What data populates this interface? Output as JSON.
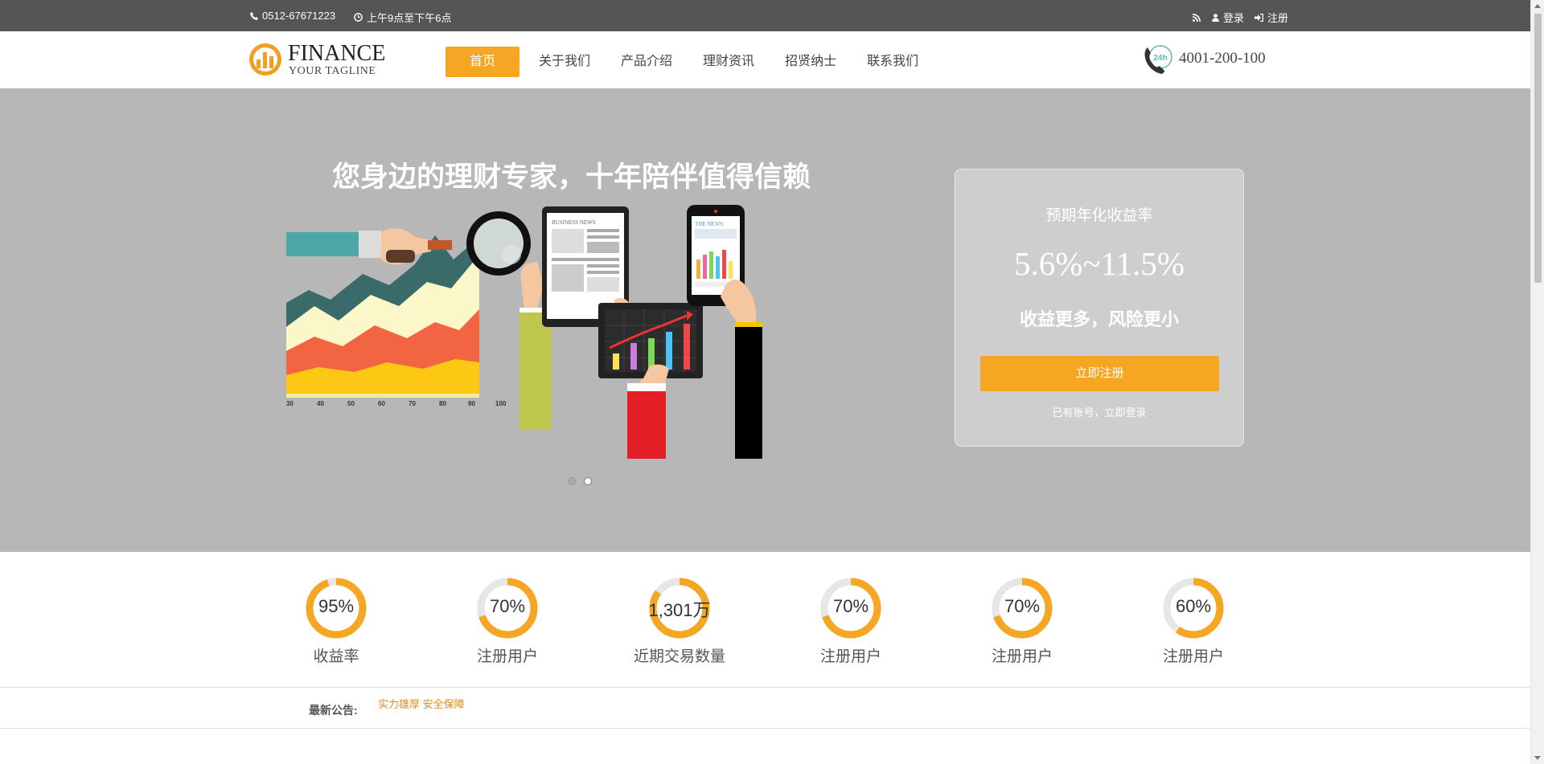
{
  "topbar": {
    "phone": "0512-67671223",
    "hours": "上午9点至下午6点",
    "login": "登录",
    "register": "注册"
  },
  "header": {
    "logo_title": "FINANCE",
    "logo_tagline": "YOUR TAGLINE",
    "nav": [
      "首页",
      "关于我们",
      "产品介绍",
      "理财资讯",
      "招贤纳士",
      "联系我们"
    ],
    "active_nav": "首页",
    "hotline_badge": "24h",
    "hotline": "4001-200-100"
  },
  "hero": {
    "title": "您身边的理财专家，十年陪伴值得信赖",
    "axis_ticks": [
      "30",
      "40",
      "50",
      "60",
      "70",
      "80",
      "90",
      "100"
    ],
    "tablet_headline": "BUSINESS NEWS",
    "phone_headline": "THE NEWS",
    "slide_count": 2,
    "active_slide": 2
  },
  "card": {
    "label": "预期年化收益率",
    "rate": "5.6%~11.5%",
    "slogan": "收益更多，风险更小",
    "register_button": "立即注册",
    "login_link": "已有账号，立即登录"
  },
  "stats": [
    {
      "value": "95%",
      "label": "收益率",
      "fraction": 0.95
    },
    {
      "value": "70%",
      "label": "注册用户",
      "fraction": 0.7
    },
    {
      "value": "1,301万",
      "label": "近期交易数量",
      "fraction": 0.85
    },
    {
      "value": "70%",
      "label": "注册用户",
      "fraction": 0.7
    },
    {
      "value": "70%",
      "label": "注册用户",
      "fraction": 0.7
    },
    {
      "value": "60%",
      "label": "注册用户",
      "fraction": 0.6
    }
  ],
  "notice": {
    "label": "最新公告:",
    "text": "实力雄厚 安全保障"
  },
  "colors": {
    "accent": "#f5a623",
    "topbar": "#555555",
    "hero_bg": "#b7b7b7"
  }
}
